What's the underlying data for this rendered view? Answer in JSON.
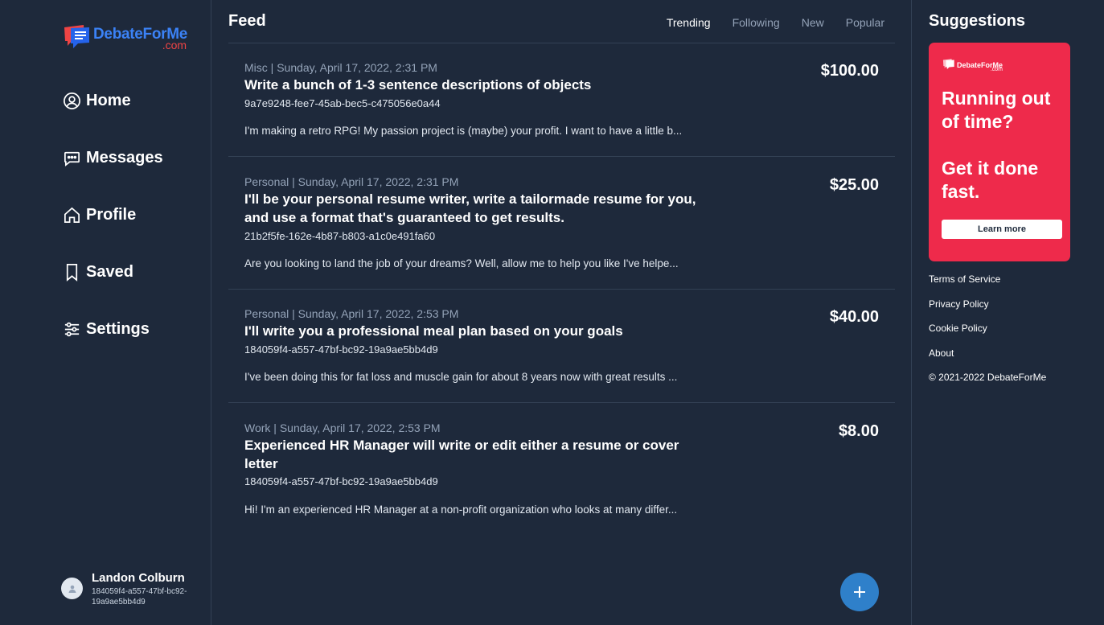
{
  "logo": {
    "name": "DebateForMe",
    "suffix": ".com"
  },
  "nav": [
    {
      "label": "Home",
      "icon": "user-circle-icon"
    },
    {
      "label": "Messages",
      "icon": "chat-bubble-icon"
    },
    {
      "label": "Profile",
      "icon": "house-icon"
    },
    {
      "label": "Saved",
      "icon": "bookmark-icon"
    },
    {
      "label": "Settings",
      "icon": "sliders-icon"
    }
  ],
  "user": {
    "name": "Landon Colburn",
    "id": "184059f4-a557-47bf-bc92-19a9ae5bb4d9"
  },
  "feed": {
    "title": "Feed",
    "tabs": [
      {
        "label": "Trending",
        "active": true
      },
      {
        "label": "Following",
        "active": false
      },
      {
        "label": "New",
        "active": false
      },
      {
        "label": "Popular",
        "active": false
      }
    ],
    "posts": [
      {
        "meta": "Misc | Sunday, April 17, 2022, 2:31 PM",
        "title": "Write a bunch of 1-3 sentence descriptions of objects",
        "id": "9a7e9248-fee7-45ab-bec5-c475056e0a44",
        "description": "I'm making a retro RPG! My passion project is (maybe) your profit. I want to have a little b...",
        "price": "$100.00"
      },
      {
        "meta": "Personal | Sunday, April 17, 2022, 2:31 PM",
        "title": "I'll be your personal resume writer, write a tailormade resume for you, and use a format that's guaranteed to get results.",
        "id": "21b2f5fe-162e-4b87-b803-a1c0e491fa60",
        "description": "Are you looking to land the job of your dreams? Well, allow me to help you like I've helpe...",
        "price": "$25.00"
      },
      {
        "meta": "Personal | Sunday, April 17, 2022, 2:53 PM",
        "title": "I'll write you a professional meal plan based on your goals",
        "id": "184059f4-a557-47bf-bc92-19a9ae5bb4d9",
        "description": "I've been doing this for fat loss and muscle gain for about 8 years now with great results ...",
        "price": "$40.00"
      },
      {
        "meta": "Work | Sunday, April 17, 2022, 2:53 PM",
        "title": "Experienced HR Manager will write or edit either a resume or cover letter",
        "id": "184059f4-a557-47bf-bc92-19a9ae5bb4d9",
        "description": "Hi! I'm an experienced HR Manager at a non-profit organization who looks at many differ...",
        "price": "$8.00"
      }
    ]
  },
  "suggestions": {
    "title": "Suggestions",
    "ad": {
      "logo_name": "DebateForMe",
      "logo_suffix": ".com",
      "headline1": "Running out of time?",
      "headline2": "Get it done fast.",
      "button": "Learn more",
      "color": "#ee2a4b"
    },
    "links": [
      "Terms of Service",
      "Privacy Policy",
      "Cookie Policy",
      "About"
    ],
    "copyright": "© 2021-2022 DebateForMe"
  },
  "colors": {
    "background": "#1e293b",
    "accent": "#2f80ca",
    "muted": "#94a3b8"
  }
}
